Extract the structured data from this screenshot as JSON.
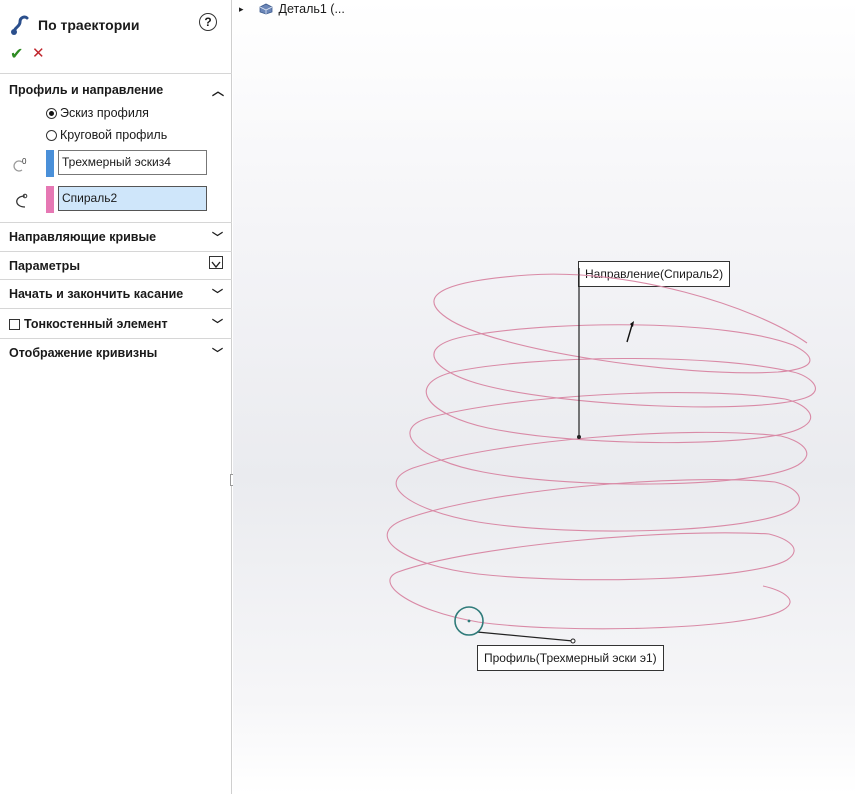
{
  "feature": {
    "title": "По траектории",
    "help": "?",
    "ok": "✔",
    "cancel": "✕"
  },
  "profile_section": {
    "title": "Профиль и направление",
    "option_sketch": "Эскиз профиля",
    "option_circular": "Круговой профиль",
    "selected_option": "Эскиз профиля",
    "profile_value": "Трехмерный эскиз4",
    "path_value": "Спираль2",
    "profile_color": "#4a90d9",
    "path_color": "#e678b4"
  },
  "sections": {
    "guide_curves": "Направляющие кривые",
    "options": "Параметры",
    "start_end_tangency": "Начать и закончить касание",
    "thin_feature": "Тонкостенный элемент",
    "curvature_display": "Отображение кривизны"
  },
  "tree": {
    "item": "Деталь1  (..."
  },
  "callouts": {
    "path": "Направление(Спираль2)",
    "profile": "Профиль(Трехмерный эски э1)"
  },
  "colors": {
    "helix": "#d98aa6",
    "profile_circle": "#2f7b7a"
  }
}
